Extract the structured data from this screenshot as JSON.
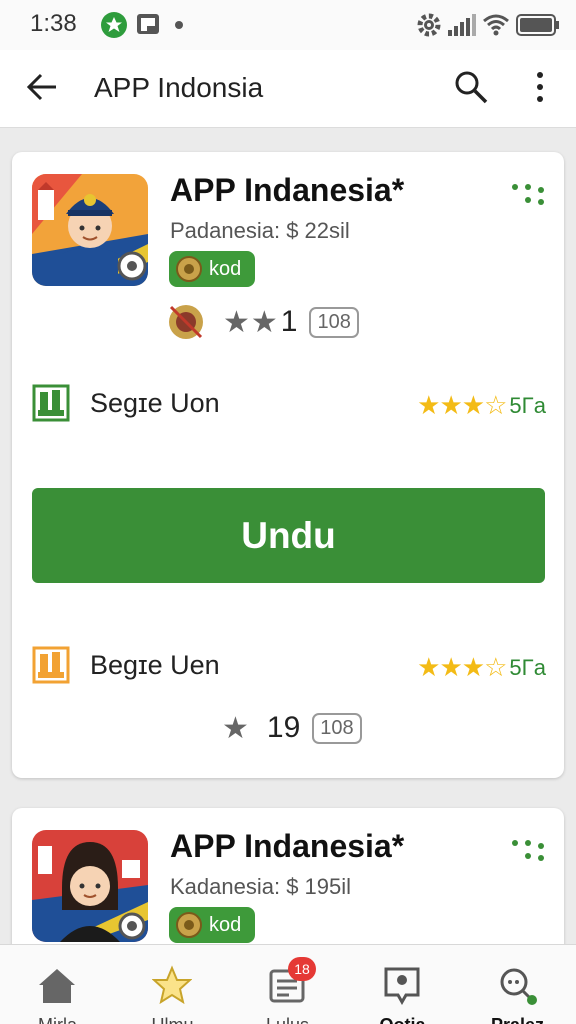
{
  "status_bar": {
    "time": "1:38"
  },
  "app_bar": {
    "title": "APP Indonsia"
  },
  "cards": [
    {
      "name": "APP Indanesia*",
      "subtitle": "Padanesia: $ 22sil",
      "pill_label": "kod",
      "rating_value": "1",
      "rating_count": "108",
      "feature_1": {
        "label": "Segɪe Uon",
        "score": "5Γa"
      },
      "download_label": "Undu",
      "feature_2": {
        "label": "Begɪe Uen",
        "score": "5Γa"
      },
      "bottom_rating_value": "19",
      "bottom_rating_count": "108"
    },
    {
      "name": "APP Indanesia*",
      "subtitle": "Kadanesia: $ 195il",
      "pill_label": "kod"
    }
  ],
  "bottom_nav": {
    "items": [
      {
        "label": "Mirla",
        "icon": "home-icon"
      },
      {
        "label": "Ulmu",
        "icon": "star-icon"
      },
      {
        "label": "Lulus",
        "icon": "list-icon",
        "badge": "18"
      },
      {
        "label": "Ootia",
        "icon": "map-pin-icon"
      },
      {
        "label": "Pralez",
        "icon": "search-icon"
      }
    ]
  },
  "colors": {
    "primary_green": "#3a8f37",
    "star_gold": "#f3bb16",
    "badge_red": "#e53935"
  }
}
